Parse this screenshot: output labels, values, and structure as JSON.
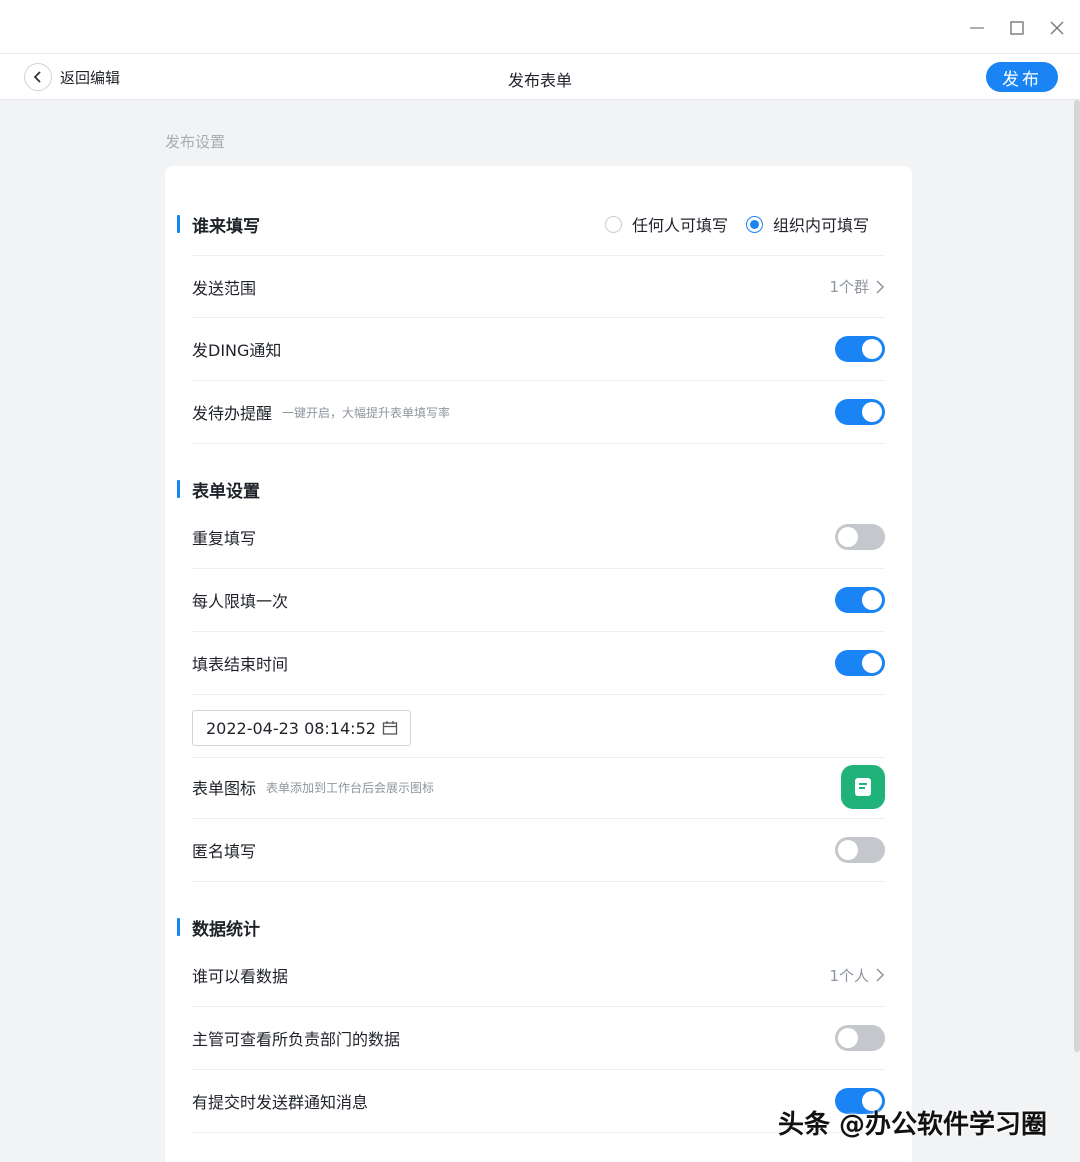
{
  "window": {
    "minimize_icon": "minimize-icon",
    "maximize_icon": "maximize-icon",
    "close_icon": "close-icon"
  },
  "header": {
    "back_label": "返回编辑",
    "title": "发布表单",
    "publish_label": "发布"
  },
  "caption": "发布设置",
  "who_fills": {
    "title": "谁来填写",
    "options": [
      "任何人可填写",
      "组织内可填写"
    ],
    "selected_index": 1,
    "rows": {
      "scope_label": "发送范围",
      "scope_value": "1个群",
      "ding_label": "发DING通知",
      "ding_on": true,
      "todo_label": "发待办提醒",
      "todo_hint": "一键开启，大幅提升表单填写率",
      "todo_on": true
    }
  },
  "form_settings": {
    "title": "表单设置",
    "repeat_label": "重复填写",
    "repeat_on": false,
    "once_label": "每人限填一次",
    "once_on": true,
    "endtime_label": "填表结束时间",
    "endtime_on": true,
    "endtime_value": "2022-04-23 08:14:52",
    "icon_label": "表单图标",
    "icon_hint": "表单添加到工作台后会展示图标",
    "anonymous_label": "匿名填写",
    "anonymous_on": false
  },
  "stats": {
    "title": "数据统计",
    "viewers_label": "谁可以看数据",
    "viewers_value": "1个人",
    "manager_label": "主管可查看所负责部门的数据",
    "manager_on": false,
    "notify_label": "有提交时发送群通知消息",
    "notify_on": true
  },
  "watermark": "头条 @办公软件学习圈",
  "colors": {
    "accent": "#1a84f5",
    "toggle_off": "#c4c7cc",
    "form_icon": "#1fb37a"
  }
}
